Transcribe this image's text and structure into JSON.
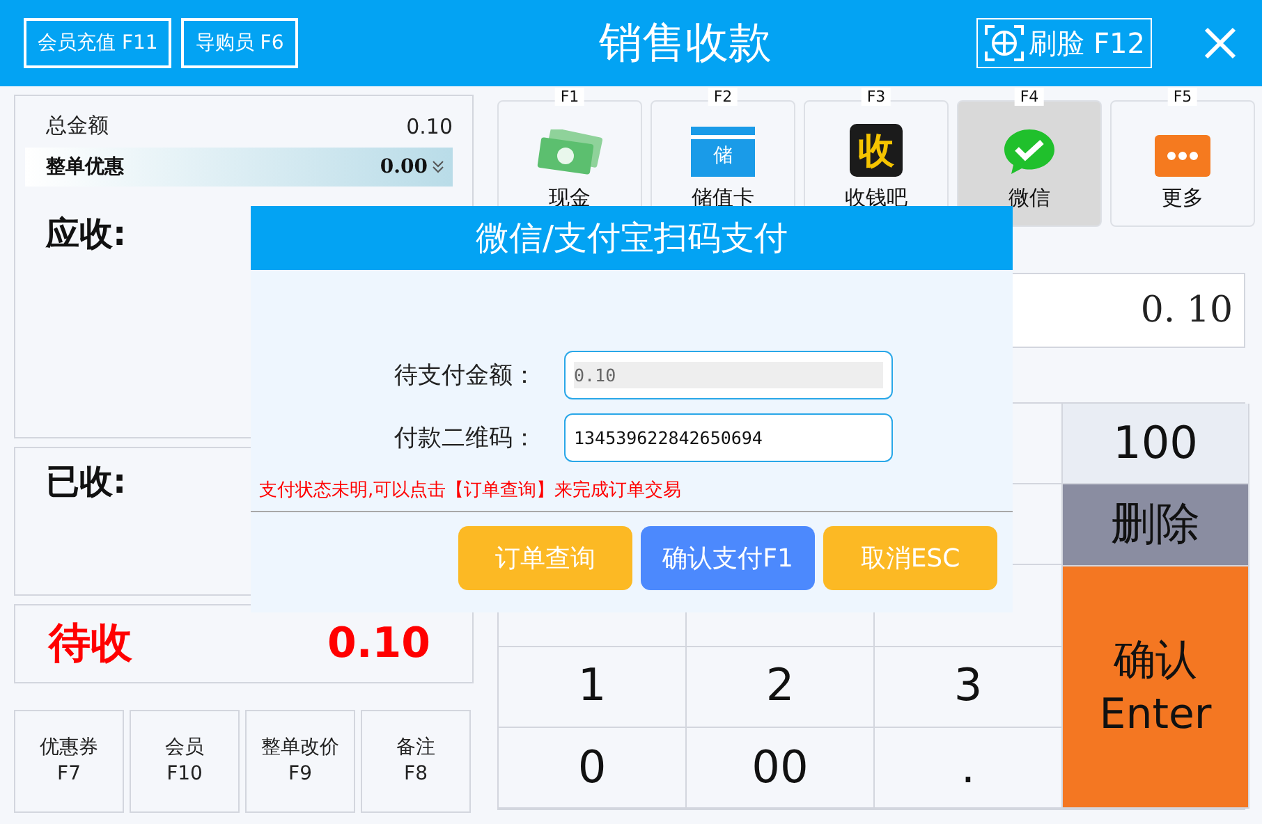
{
  "header": {
    "buttons": [
      {
        "label": "会员充值 F11"
      },
      {
        "label": "导购员 F6"
      }
    ],
    "title": "销售收款",
    "face_button": {
      "label": "刷脸 F12"
    }
  },
  "summary": {
    "total_label": "总金额",
    "total_value": "0.10",
    "discount_label": "整单优惠",
    "discount_value": "0.00",
    "receivable_label": "应收:",
    "received_label": "已收:",
    "pending_label": "待收",
    "pending_value": "0.10"
  },
  "function_buttons": [
    {
      "label": "优惠券",
      "key": "F7"
    },
    {
      "label": "会员",
      "key": "F10"
    },
    {
      "label": "整单改价",
      "key": "F9"
    },
    {
      "label": "备注",
      "key": "F8"
    }
  ],
  "payment_methods": [
    {
      "key": "F1",
      "label": "现金",
      "kind": "cash",
      "selected": false
    },
    {
      "key": "F2",
      "label": "储值卡",
      "kind": "card",
      "icon_text": "储",
      "selected": false
    },
    {
      "key": "F3",
      "label": "收钱吧",
      "kind": "badge",
      "icon_text": "收",
      "selected": false
    },
    {
      "key": "F4",
      "label": "微信",
      "kind": "wechat",
      "selected": true
    },
    {
      "key": "F5",
      "label": "更多",
      "kind": "more",
      "selected": false
    }
  ],
  "amount_input": {
    "value": "0. 10"
  },
  "digit_keys": [
    {
      "label": "1"
    },
    {
      "label": "2"
    },
    {
      "label": "3"
    },
    {
      "label": "0"
    },
    {
      "label": "00"
    },
    {
      "label": "."
    }
  ],
  "side_keys": [
    {
      "label": "100",
      "kind": "quick"
    },
    {
      "label": "删除",
      "kind": "delete"
    },
    {
      "label": "确认\nEnter",
      "kind": "confirm"
    }
  ],
  "dialog": {
    "title": "微信/支付宝扫码支付",
    "fields": [
      {
        "label": "待支付金额：",
        "value": "0.10",
        "disabled": true
      },
      {
        "label": "付款二维码：",
        "value": "134539622842650694",
        "disabled": false
      }
    ],
    "message": "支付状态未明,可以点击【订单查询】来完成订单交易",
    "buttons": [
      {
        "label": "订单查询",
        "kind": "secondary"
      },
      {
        "label": "确认支付F1",
        "kind": "primary"
      },
      {
        "label": "取消ESC",
        "kind": "secondary"
      }
    ]
  }
}
